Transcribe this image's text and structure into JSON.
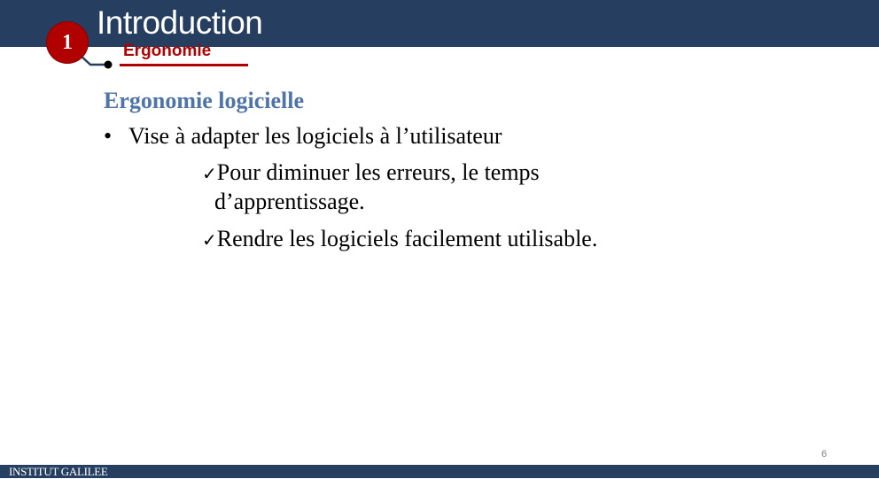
{
  "header": {
    "title": "Introduction",
    "section_number": "1",
    "subtitle": "Ergonomie"
  },
  "content": {
    "heading": "Ergonomie logicielle",
    "bullets": [
      {
        "marker": "•",
        "text": "Vise à adapter les logiciels à l’utilisateur",
        "sub_items": [
          {
            "icon": "check-icon",
            "marker": "✓",
            "text": "Pour diminuer les erreurs, le temps",
            "continuation": "d’apprentissage."
          },
          {
            "icon": "check-icon",
            "marker": "✓",
            "text": "Rendre les logiciels facilement utilisable."
          }
        ]
      }
    ]
  },
  "footer": {
    "institution": "INSTITUT GALILEE",
    "page_number": "6"
  },
  "colors": {
    "header_bg": "#263f61",
    "accent_red": "#b00000",
    "heading_blue": "#4f74a8"
  }
}
